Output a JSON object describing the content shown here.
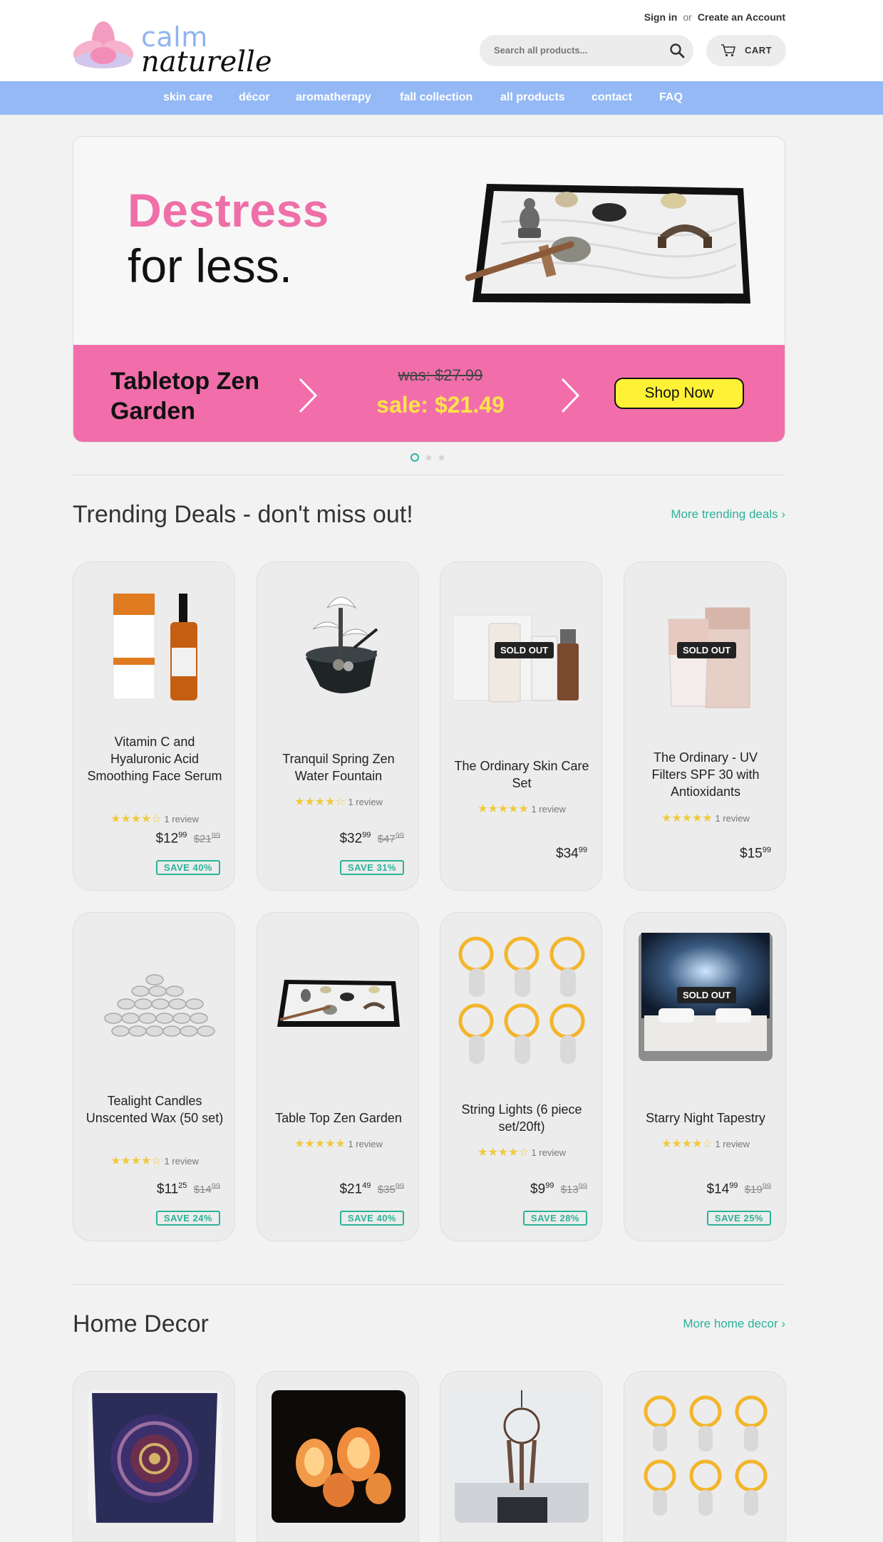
{
  "header": {
    "logo_top": "calm",
    "logo_bottom": "naturelle",
    "sign_in": "Sign in",
    "or": "or",
    "create_account": "Create an Account",
    "search_placeholder": "Search all products...",
    "cart_label": "CART"
  },
  "nav": {
    "items": [
      "skin care",
      "décor",
      "aromatherapy",
      "fall collection",
      "all products",
      "contact",
      "FAQ"
    ]
  },
  "hero": {
    "headline_1": "Destress",
    "headline_2": "for less.",
    "product_name": "Tabletop Zen Garden",
    "was_price": "was: $27.99",
    "sale_price": "sale: $21.49",
    "cta": "Shop Now",
    "slides_count": 3,
    "active_slide": 1
  },
  "trending": {
    "title": "Trending Deals - don't miss out!",
    "more_link": "More trending deals ›",
    "products": [
      {
        "title": "Vitamin C and Hyaluronic Acid Smoothing Face Serum",
        "rating": 4,
        "reviews": "1 review",
        "price_main": "$12",
        "price_cents": "99",
        "old_price": "$21",
        "old_cents": "99",
        "save": "SAVE 40%",
        "sold_out": ""
      },
      {
        "title": "Tranquil Spring Zen Water Fountain",
        "rating": 4,
        "reviews": "1 review",
        "price_main": "$32",
        "price_cents": "99",
        "old_price": "$47",
        "old_cents": "99",
        "save": "SAVE 31%",
        "sold_out": ""
      },
      {
        "title": "The Ordinary Skin Care Set",
        "rating": 5,
        "reviews": "1 review",
        "price_main": "$34",
        "price_cents": "99",
        "old_price": "",
        "old_cents": "",
        "save": "",
        "sold_out": "SOLD OUT"
      },
      {
        "title": "The Ordinary - UV Filters SPF 30 with Antioxidants",
        "rating": 5,
        "reviews": "1 review",
        "price_main": "$15",
        "price_cents": "99",
        "old_price": "",
        "old_cents": "",
        "save": "",
        "sold_out": "SOLD OUT"
      },
      {
        "title": "Tealight Candles Unscented Wax (50 set)",
        "rating": 4,
        "reviews": "1 review",
        "price_main": "$11",
        "price_cents": "25",
        "old_price": "$14",
        "old_cents": "99",
        "save": "SAVE 24%",
        "sold_out": ""
      },
      {
        "title": "Table Top Zen Garden",
        "rating": 5,
        "reviews": "1 review",
        "price_main": "$21",
        "price_cents": "49",
        "old_price": "$35",
        "old_cents": "99",
        "save": "SAVE 40%",
        "sold_out": ""
      },
      {
        "title": "String Lights (6 piece set/20ft)",
        "rating": 4,
        "reviews": "1 review",
        "price_main": "$9",
        "price_cents": "99",
        "old_price": "$13",
        "old_cents": "99",
        "save": "SAVE 28%",
        "sold_out": ""
      },
      {
        "title": "Starry Night Tapestry",
        "rating": 4,
        "reviews": "1 review",
        "price_main": "$14",
        "price_cents": "99",
        "old_price": "$19",
        "old_cents": "99",
        "save": "SAVE 25%",
        "sold_out": "SOLD OUT"
      }
    ]
  },
  "home_decor": {
    "title": "Home Decor",
    "more_link": "More home decor ›"
  },
  "colors": {
    "nav_bg": "#94b9f5",
    "accent_pink": "#f16eaa",
    "accent_green": "#2bb39a",
    "star": "#f0c93e",
    "sale_yellow": "#ffe34a"
  },
  "icons": [
    "lotus-logo-icon",
    "search-icon",
    "cart-icon",
    "chevron-right-icon",
    "star-icon"
  ]
}
